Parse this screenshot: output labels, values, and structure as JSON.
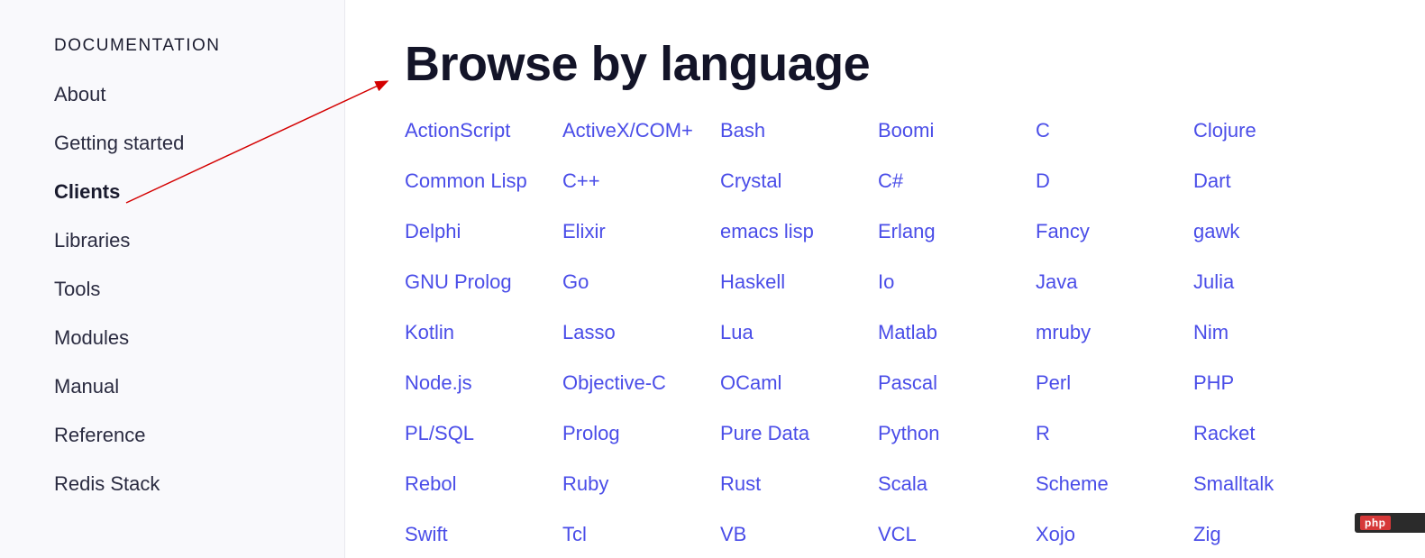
{
  "sidebar": {
    "heading": "DOCUMENTATION",
    "items": [
      {
        "label": "About",
        "active": false
      },
      {
        "label": "Getting started",
        "active": false
      },
      {
        "label": "Clients",
        "active": true
      },
      {
        "label": "Libraries",
        "active": false
      },
      {
        "label": "Tools",
        "active": false
      },
      {
        "label": "Modules",
        "active": false
      },
      {
        "label": "Manual",
        "active": false
      },
      {
        "label": "Reference",
        "active": false
      },
      {
        "label": "Redis Stack",
        "active": false
      }
    ]
  },
  "main": {
    "title": "Browse by language",
    "languages": [
      "ActionScript",
      "ActiveX/COM+",
      "Bash",
      "Boomi",
      "C",
      "Clojure",
      "Common Lisp",
      "C++",
      "Crystal",
      "C#",
      "D",
      "Dart",
      "Delphi",
      "Elixir",
      "emacs lisp",
      "Erlang",
      "Fancy",
      "gawk",
      "GNU Prolog",
      "Go",
      "Haskell",
      "Io",
      "Java",
      "Julia",
      "Kotlin",
      "Lasso",
      "Lua",
      "Matlab",
      "mruby",
      "Nim",
      "Node.js",
      "Objective-C",
      "OCaml",
      "Pascal",
      "Perl",
      "PHP",
      "PL/SQL",
      "Prolog",
      "Pure Data",
      "Python",
      "R",
      "Racket",
      "Rebol",
      "Ruby",
      "Rust",
      "Scala",
      "Scheme",
      "Smalltalk",
      "Swift",
      "Tcl",
      "VB",
      "VCL",
      "Xojo",
      "Zig"
    ]
  },
  "badge": {
    "text": "php"
  }
}
